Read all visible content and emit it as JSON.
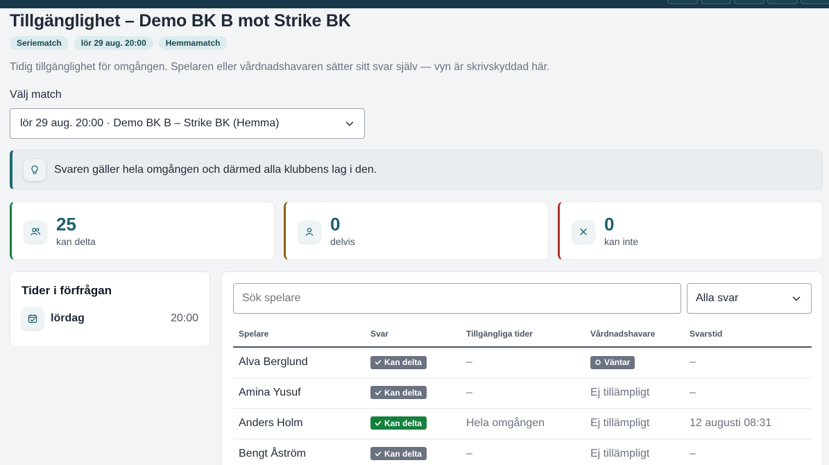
{
  "page": {
    "title": "Tillgänglighet – Demo BK B mot Strike BK",
    "chips": [
      "Seriematch",
      "lör 29 aug. 20:00",
      "Hemmamatch"
    ],
    "description": "Tidig tillgänglighet för omgången. Spelaren eller vårdnadshavaren sätter sitt svar själv — vyn är skrivskyddad här.",
    "match_select_label": "Välj match",
    "match_select_value": "lör 29 aug. 20:00 · Demo BK B – Strike BK (Hemma)"
  },
  "info": {
    "icon": "lightbulb-icon",
    "text": "Svaren gäller hela omgången och därmed alla klubbens lag i den."
  },
  "stats": [
    {
      "value": "25",
      "label": "kan delta",
      "icon": "users-icon",
      "color": "#16813f"
    },
    {
      "value": "0",
      "label": "delvis",
      "icon": "user-icon",
      "color": "#8a6314"
    },
    {
      "value": "0",
      "label": "kan inte",
      "icon": "close-icon",
      "color": "#b4322a"
    }
  ],
  "times": {
    "title": "Tider i förfrågan",
    "day": "lördag",
    "time": "20:00"
  },
  "players": {
    "search_placeholder": "Sök spelare",
    "filter_value": "Alla svar",
    "columns": [
      "Spelare",
      "Svar",
      "Tillgängliga tider",
      "Vårdnadshavare",
      "Svarstid"
    ],
    "rows": [
      {
        "name": "Alva Berglund",
        "answer": "Kan delta",
        "answer_style": "gray",
        "times": "–",
        "guardian": "Väntar",
        "guardian_badge": true,
        "response_time": "–"
      },
      {
        "name": "Amina Yusuf",
        "answer": "Kan delta",
        "answer_style": "gray",
        "times": "–",
        "guardian": "Ej tillämpligt",
        "guardian_badge": false,
        "response_time": "–"
      },
      {
        "name": "Anders Holm",
        "answer": "Kan delta",
        "answer_style": "green",
        "times": "Hela omgången",
        "guardian": "Ej tillämpligt",
        "guardian_badge": false,
        "response_time": "12 augusti 08:31"
      },
      {
        "name": "Bengt Åström",
        "answer": "Kan delta",
        "answer_style": "gray",
        "times": "–",
        "guardian": "Ej tillämpligt",
        "guardian_badge": false,
        "response_time": "–"
      }
    ]
  }
}
